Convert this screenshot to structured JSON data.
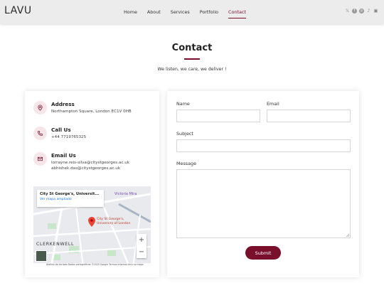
{
  "header": {
    "logo": "LAVU",
    "nav": [
      "Home",
      "About",
      "Services",
      "Portfolio",
      "Contact"
    ],
    "active_nav": "Contact",
    "socials": [
      "x-icon",
      "facebook-icon",
      "instagram-icon",
      "tiktok-icon",
      "linkedin-icon"
    ]
  },
  "page": {
    "title": "Contact",
    "subtitle": "We listen, we care, we deliver !"
  },
  "info": {
    "address": {
      "title": "Address",
      "lines": [
        "Northampton Square, London EC1V 0HB"
      ]
    },
    "call": {
      "title": "Call Us",
      "lines": [
        "+44 7719765325"
      ]
    },
    "email": {
      "title": "Email Us",
      "lines": [
        "lorrayne.reis-silva@citystgeorges.ac.uk",
        "abhishek.das@citystgeorges.ac.uk"
      ]
    }
  },
  "map": {
    "place_title": "City St George's, Universit...",
    "link": "Ver mapa ampliado",
    "marker_label": "City St George's, University of London",
    "area_label": "CLERKENWELL",
    "station": "Victoria Mira",
    "footer": "Atalhos do teclado  Dados cartográficos ©2025 Google  Termos  Informar erro no mapa",
    "zoom_in": "+",
    "zoom_out": "−"
  },
  "form": {
    "name_label": "Name",
    "email_label": "Email",
    "subject_label": "Subject",
    "message_label": "Message",
    "submit_label": "Submit"
  },
  "colors": {
    "accent": "#7a0f2c",
    "icon_bg": "#f6e6ea"
  }
}
